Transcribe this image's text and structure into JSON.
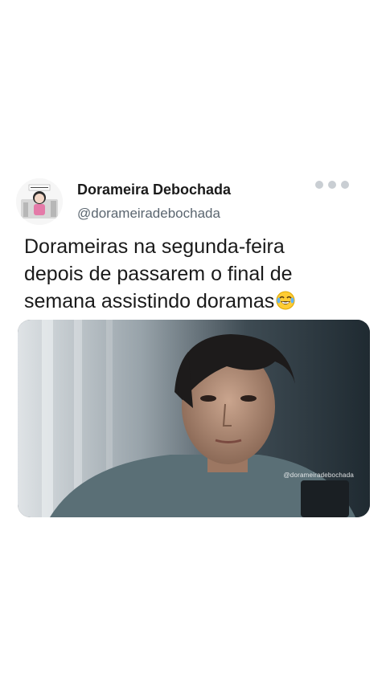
{
  "post": {
    "author": {
      "display_name": "Dorameira Debochada",
      "handle": "@dorameiradebochada",
      "avatar_caption": "Dorameira Debochada"
    },
    "text": "Dorameiras na segunda-feira\ndepois de passarem o final de\nsemana assistindo doramas",
    "emoji": "face-with-tears-of-joy",
    "media": {
      "kind": "video-still",
      "watermark": "@dorameiradebochada"
    }
  }
}
